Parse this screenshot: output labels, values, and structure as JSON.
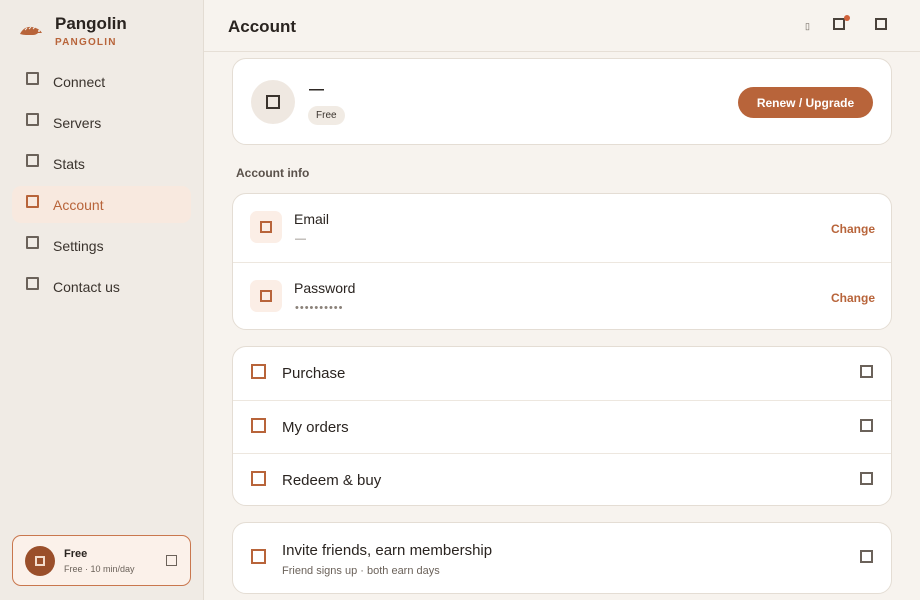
{
  "sidebar": {
    "brand": {
      "name": "Pangolin",
      "sub": "PANGOLIN"
    },
    "items": [
      {
        "label": "Connect",
        "active": false
      },
      {
        "label": "Servers",
        "active": false
      },
      {
        "label": "Stats",
        "active": false
      },
      {
        "label": "Account",
        "active": true
      },
      {
        "label": "Settings",
        "active": false
      },
      {
        "label": "Contact us",
        "active": false
      }
    ],
    "plan": {
      "name": "Free",
      "sub": "Free · 10 min/day"
    }
  },
  "header": {
    "title": "Account",
    "small_glyph": "▯"
  },
  "profile": {
    "name": "—",
    "badge": "Free",
    "action": "Renew / Upgrade"
  },
  "account_info": {
    "title": "Account info",
    "rows": [
      {
        "label": "Email",
        "value": "—",
        "action": "Change"
      },
      {
        "label": "Password",
        "value": "••••••••••",
        "action": "Change"
      }
    ]
  },
  "menu": {
    "items": [
      {
        "label": "Purchase"
      },
      {
        "label": "My orders"
      },
      {
        "label": "Redeem & buy"
      }
    ]
  },
  "invite": {
    "label": "Invite friends, earn membership",
    "sub": "Friend signs up · both earn days"
  },
  "colors": {
    "accent": "#b8643a",
    "active_bg": "#f8e9df",
    "sidebar_bg": "#f0ebe5",
    "page_bg": "#f7f3ee"
  }
}
